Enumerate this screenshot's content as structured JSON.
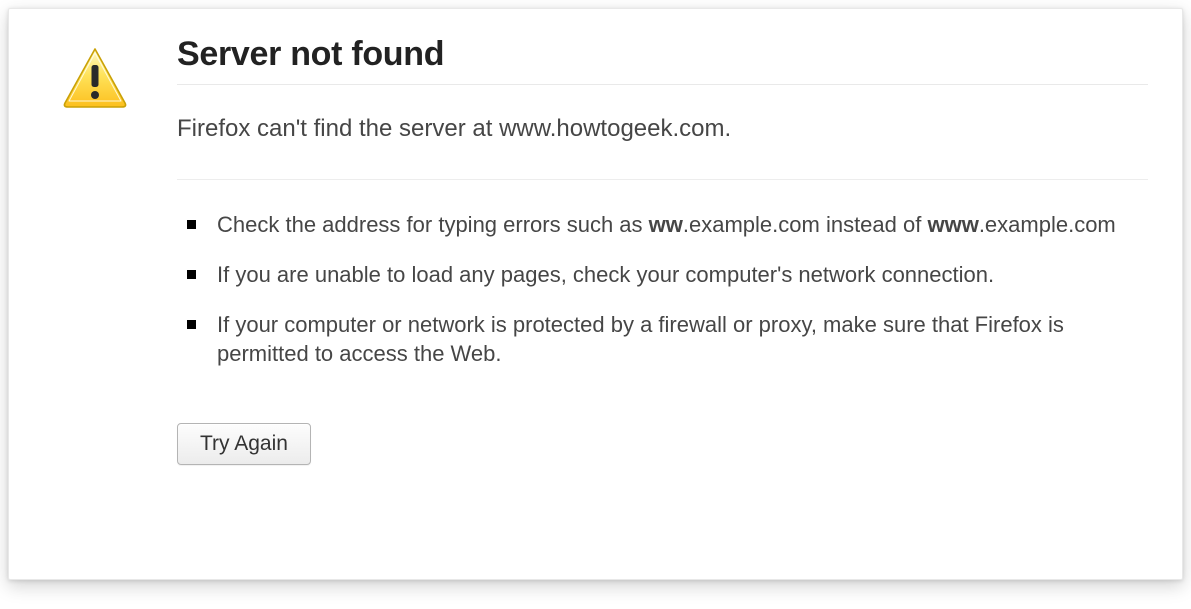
{
  "error": {
    "title": "Server not found",
    "subtitle_prefix": "Firefox can't find the server at ",
    "subtitle_host": "www.howtogeek.com",
    "subtitle_suffix": ".",
    "item1": {
      "a": "Check the address for typing errors such as ",
      "bad": "ww",
      "b": ".example.com instead of ",
      "good": "www",
      "c": ".example.com"
    },
    "item2": "If you are unable to load any pages, check your computer's network connection.",
    "item3": "If your computer or network is protected by a firewall or proxy, make sure that Firefox is permitted to access the Web.",
    "retry_label": "Try Again"
  }
}
